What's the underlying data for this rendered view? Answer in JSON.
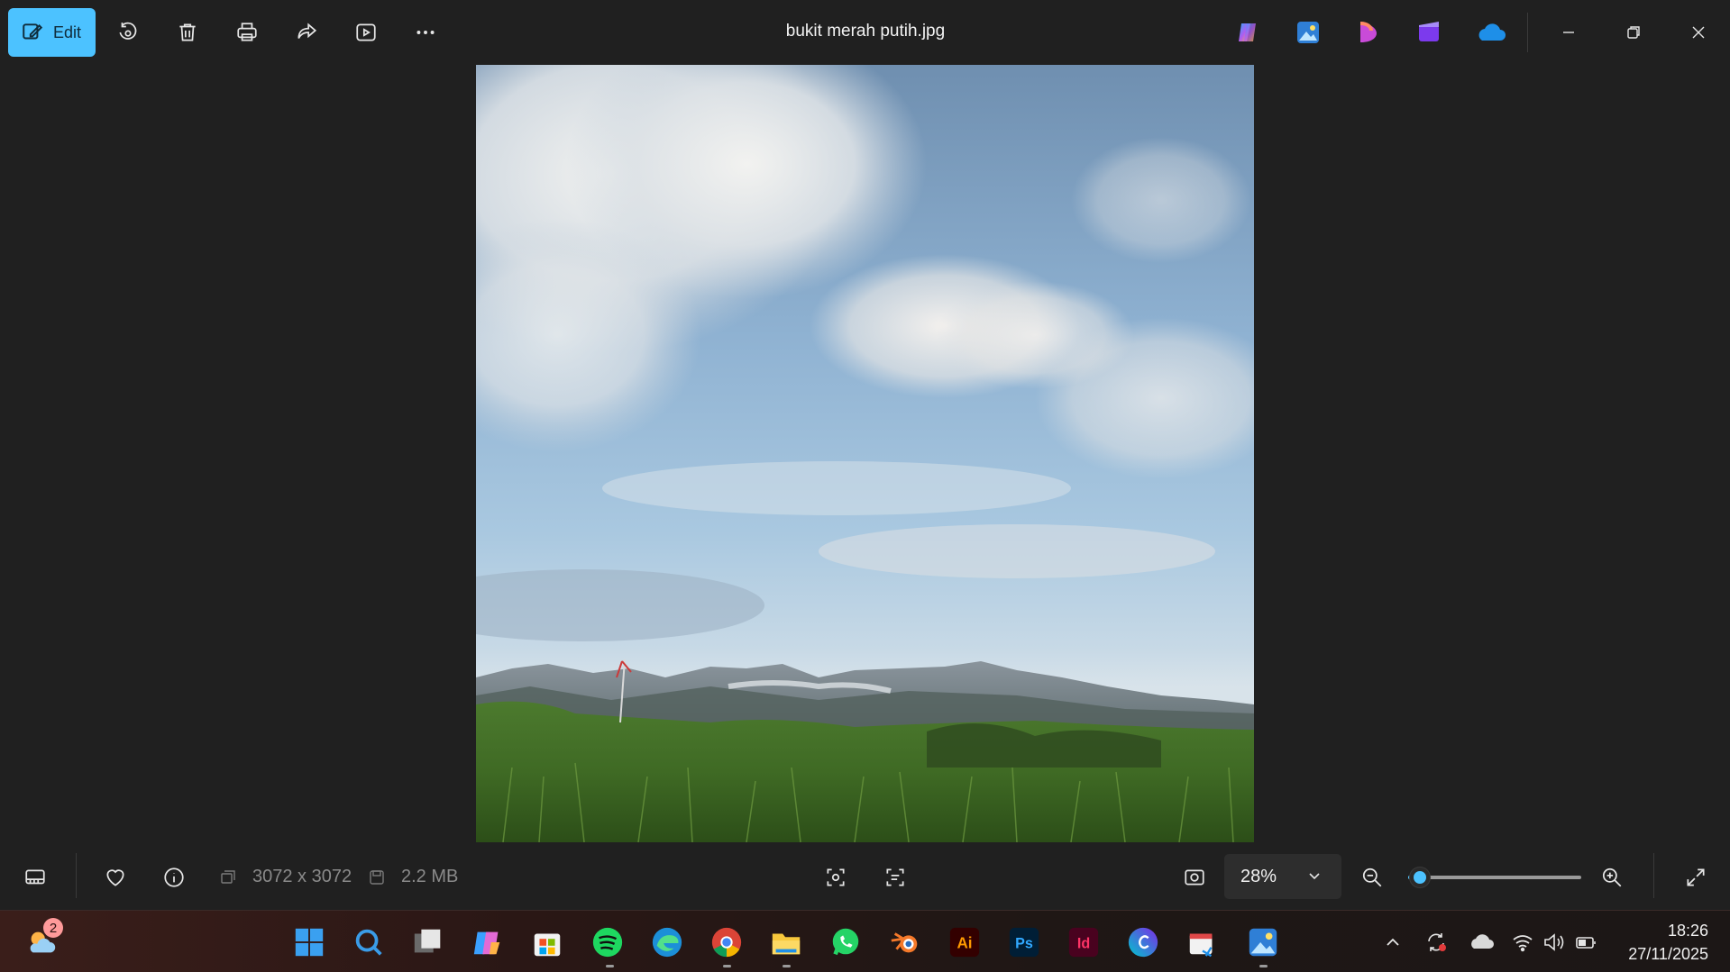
{
  "titlebar": {
    "edit_label": "Edit",
    "file_name": "bukit merah putih.jpg",
    "icons": [
      "edit-icon",
      "rotate-icon",
      "delete-icon",
      "print-icon",
      "share-icon",
      "slideshow-icon",
      "more-icon"
    ],
    "app_icons": [
      "copilot-icon",
      "photos-icon",
      "designer-icon",
      "clipchamp-icon",
      "onedrive-icon"
    ],
    "window_controls": [
      "minimize-icon",
      "restore-icon",
      "close-icon"
    ]
  },
  "bottombar": {
    "dimensions": "3072 x 3072",
    "file_size": "2.2 MB",
    "zoom_value": "28%",
    "zoom_level": 0.07
  },
  "taskbar": {
    "weather_badge": "2",
    "apps": [
      "start",
      "search",
      "task-view",
      "copilot",
      "store",
      "spotify",
      "edge",
      "chrome",
      "file-explorer",
      "whatsapp",
      "blender",
      "illustrator",
      "photoshop",
      "indesign",
      "canva",
      "snipping-tool",
      "photos"
    ],
    "clock_time": "18:26",
    "clock_date": "27/11/2025"
  },
  "colors": {
    "accent": "#4cc2ff",
    "background": "#202020",
    "toolbar_text": "#8a8a8a"
  }
}
